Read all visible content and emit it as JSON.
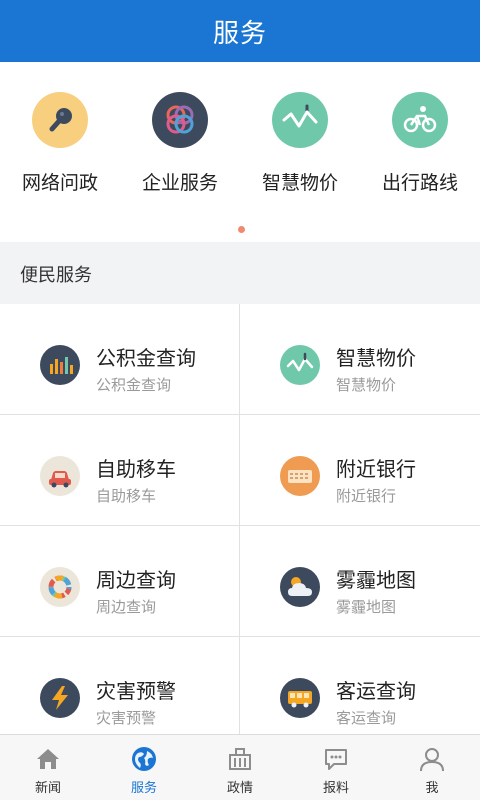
{
  "header": {
    "title": "服务"
  },
  "quick_services": [
    {
      "label": "网络问政",
      "icon": "microphone-icon",
      "color": "#f7cf7e"
    },
    {
      "label": "企业服务",
      "icon": "rings-icon",
      "color": "#3d4a5e"
    },
    {
      "label": "智慧物价",
      "icon": "price-trend-icon",
      "color": "#6fc8a9"
    },
    {
      "label": "出行路线",
      "icon": "bicycle-icon",
      "color": "#6fc8a9"
    }
  ],
  "section": {
    "title": "便民服务"
  },
  "services": [
    {
      "title": "公积金查询",
      "subtitle": "公积金查询",
      "icon": "equalizer-icon",
      "color": "#3d4a5e"
    },
    {
      "title": "智慧物价",
      "subtitle": "智慧物价",
      "icon": "price-trend-icon",
      "color": "#6fc8a9"
    },
    {
      "title": "自助移车",
      "subtitle": "自助移车",
      "icon": "car-icon",
      "color": "#ece5d9"
    },
    {
      "title": "附近银行",
      "subtitle": "附近银行",
      "icon": "bank-card-icon",
      "color": "#ef9b52"
    },
    {
      "title": "周边查询",
      "subtitle": "周边查询",
      "icon": "color-wheel-icon",
      "color": "#ece5d9"
    },
    {
      "title": "雾霾地图",
      "subtitle": "雾霾地图",
      "icon": "cloud-sun-icon",
      "color": "#3d4a5e"
    },
    {
      "title": "灾害预警",
      "subtitle": "灾害预警",
      "icon": "lightning-icon",
      "color": "#3d4a5e"
    },
    {
      "title": "客运查询",
      "subtitle": "客运查询",
      "icon": "bus-icon",
      "color": "#3d4a5e"
    }
  ],
  "tabs": [
    {
      "label": "新闻",
      "icon": "home-icon",
      "active": false
    },
    {
      "label": "服务",
      "icon": "globe-icon",
      "active": true
    },
    {
      "label": "政情",
      "icon": "building-icon",
      "active": false
    },
    {
      "label": "报料",
      "icon": "chat-bubble-icon",
      "active": false
    },
    {
      "label": "我",
      "icon": "user-icon",
      "active": false
    }
  ],
  "colors": {
    "primary": "#1a76d2",
    "indicator_dot": "#f08a6e"
  }
}
